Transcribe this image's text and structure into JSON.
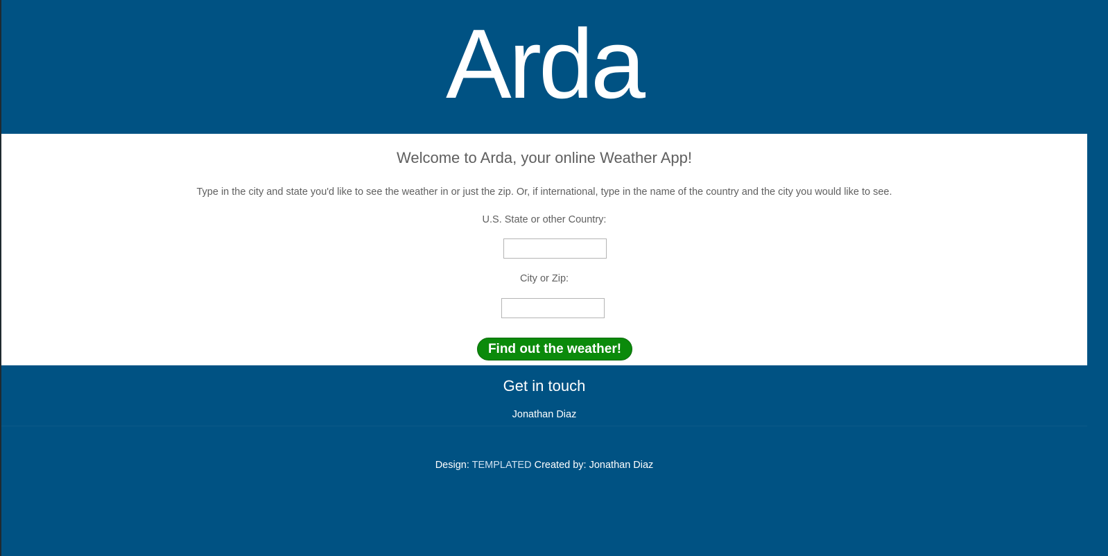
{
  "header": {
    "title": "Arda"
  },
  "main": {
    "welcome": "Welcome to Arda, your online Weather App!",
    "intro": "Type in the city and state you'd like to see the weather in or just the zip. Or, if international, type in the name of the country and the city you would like to see.",
    "state_label": "U.S. State or other Country:",
    "state_value": "",
    "city_label": "City or Zip:",
    "city_value": "",
    "submit_label": "Find out the weather!"
  },
  "contact": {
    "title": "Get in touch",
    "name": "Jonathan Diaz"
  },
  "footer": {
    "design_prefix": "Design:",
    "design_link": "TEMPLATED",
    "created_by": "Created by: Jonathan Diaz"
  },
  "colors": {
    "brand_blue": "#005283",
    "button_green": "#0b8a0b",
    "text_gray": "#5f5f5f"
  }
}
